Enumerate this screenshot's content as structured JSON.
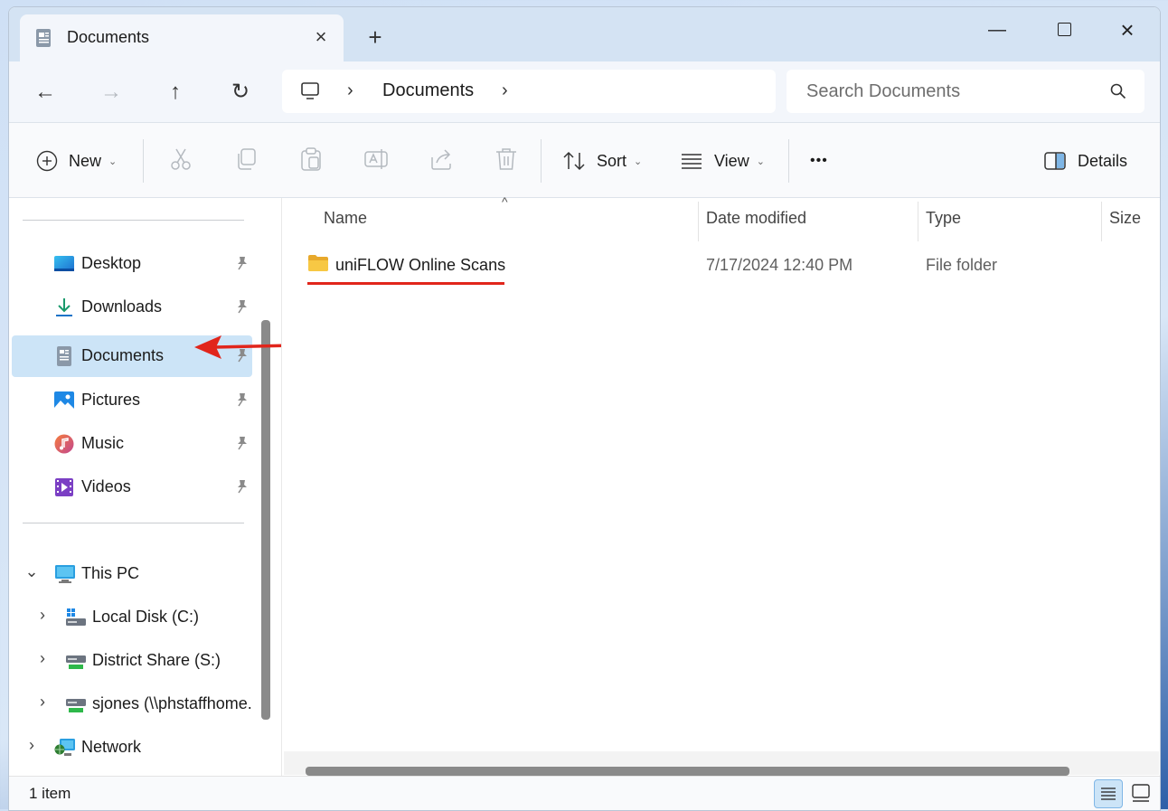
{
  "window": {
    "tab_title": "Documents",
    "tab_close": "×",
    "new_tab": "+",
    "minimize": "—",
    "close": "×"
  },
  "nav": {
    "back": "←",
    "forward": "→",
    "up": "↑",
    "refresh": "↻",
    "address": {
      "chevron": "›",
      "segment": "Documents"
    },
    "search": {
      "placeholder": "Search Documents"
    }
  },
  "commands": {
    "new_label": "New",
    "sort_label": "Sort",
    "view_label": "View",
    "more_label": "•••",
    "details_label": "Details",
    "dropdown": "⌄"
  },
  "sidebar": {
    "quick_access": [
      {
        "label": "Desktop",
        "icon": "desktop-icon",
        "pinned": true
      },
      {
        "label": "Downloads",
        "icon": "download-icon",
        "pinned": true
      },
      {
        "label": "Documents",
        "icon": "documents-icon",
        "pinned": true,
        "selected": true
      },
      {
        "label": "Pictures",
        "icon": "pictures-icon",
        "pinned": true
      },
      {
        "label": "Music",
        "icon": "music-icon",
        "pinned": true
      },
      {
        "label": "Videos",
        "icon": "videos-icon",
        "pinned": true
      }
    ],
    "tree": [
      {
        "label": "This PC",
        "icon": "pc-icon",
        "expanded": true
      },
      {
        "label": "Local Disk (C:)",
        "icon": "drive-icon",
        "expanded": false
      },
      {
        "label": "District Share (S:)",
        "icon": "network-drive-icon",
        "expanded": false
      },
      {
        "label": "sjones (\\\\phstaffhome.",
        "icon": "network-drive-icon",
        "expanded": false
      },
      {
        "label": "Network",
        "icon": "network-icon",
        "expanded": false
      }
    ]
  },
  "columns": {
    "name": "Name",
    "date_modified": "Date modified",
    "type": "Type",
    "size": "Size",
    "sort_caret": "^"
  },
  "files": [
    {
      "name": "uniFLOW Online Scans",
      "date_modified": "7/17/2024 12:40 PM",
      "type": "File folder"
    }
  ],
  "status": {
    "item_count": "1 item"
  },
  "colors": {
    "accent": "#0067c0",
    "selection": "#cce4f7",
    "annotation_red": "#e1251b",
    "folder_yellow": "#f7c844"
  }
}
